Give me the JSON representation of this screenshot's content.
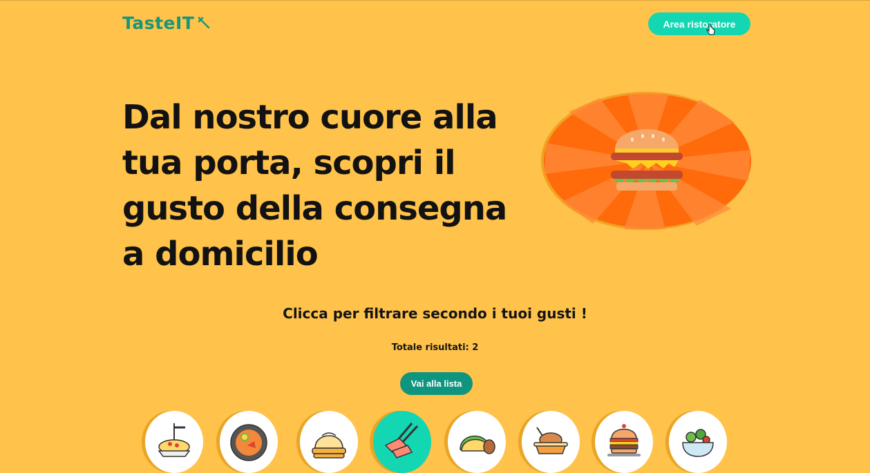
{
  "header": {
    "logo_text": "TasteIT",
    "logo_icon": "fork-icon",
    "area_button_label": "Area ristoratore"
  },
  "hero": {
    "title": "Dal nostro cuore alla tua porta, scopri il gusto della consegna a domicilio",
    "image_icon": "burger-icon"
  },
  "filter": {
    "heading": "Clicca per filtrare secondo i tuoi gusti !",
    "total_text": "Totale risultati: 2",
    "list_button_label": "Vai alla lista"
  },
  "categories": [
    {
      "icon": "spaghetti-icon",
      "active": false
    },
    {
      "icon": "pizza-icon",
      "active": false
    },
    {
      "icon": "dumplings-icon",
      "active": false
    },
    {
      "icon": "sushi-icon",
      "active": true
    },
    {
      "icon": "taco-icon",
      "active": false
    },
    {
      "icon": "chicken-rice-icon",
      "active": false
    },
    {
      "icon": "burger-icon",
      "active": false
    },
    {
      "icon": "salad-icon",
      "active": false
    }
  ],
  "colors": {
    "background": "#ffc24a",
    "brand": "#14977a",
    "accent": "#13d6b3",
    "button_dark": "#0e957f",
    "sunburst": "#ff6a0a"
  }
}
